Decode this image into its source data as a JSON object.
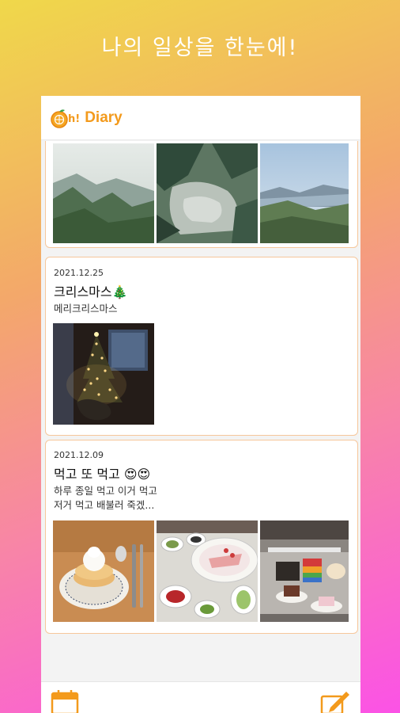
{
  "headline": "나의 일상을 한눈에!",
  "app": {
    "title": "Diary",
    "logo_text": "h!"
  },
  "entries": [
    {
      "date": "",
      "title": "",
      "body": "",
      "photos": [
        "mountain-valley-photo",
        "rocky-pine-photo",
        "summit-view-photo"
      ]
    },
    {
      "date": "2021.12.25",
      "title": "크리스마스🎄",
      "body": "메리크리스마스",
      "photos": [
        "christmas-tree-photo"
      ]
    },
    {
      "date": "2021.12.09",
      "title": "먹고 또 먹고 😍😍",
      "body_line1": "하루 종일 먹고 이거 먹고",
      "body_line2": "저거 먹고 배불러 죽겠...",
      "photos": [
        "pancake-photo",
        "sashimi-platter-photo",
        "dessert-buffet-photo"
      ]
    }
  ],
  "bottom_nav": {
    "left_icon": "calendar-icon",
    "right_icon": "edit-icon"
  },
  "colors": {
    "accent": "#f39a1c",
    "card_border": "#f6c79b"
  }
}
